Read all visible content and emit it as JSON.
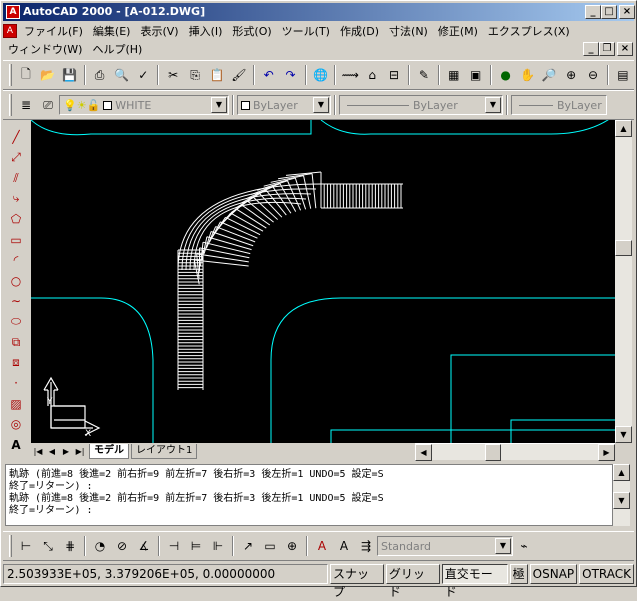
{
  "window": {
    "title": "AutoCAD 2000 - [A-012.DWG]",
    "app_icon": "A"
  },
  "menu": {
    "row1": [
      "ファイル(F)",
      "編集(E)",
      "表示(V)",
      "挿入(I)",
      "形式(O)",
      "ツール(T)",
      "作成(D)",
      "寸法(N)",
      "修正(M)",
      "エクスプレス(X)"
    ],
    "row2": [
      "ウィンドウ(W)",
      "ヘルプ(H)"
    ]
  },
  "layer": {
    "name": "WHITE",
    "color": "ByLayer",
    "linetype": "ByLayer",
    "lineweight": "ByLayer"
  },
  "tabs": {
    "model": "モデル",
    "layout": "レイアウト1"
  },
  "command": {
    "lines": [
      "軌跡 (前進=8 後進=2 前右折=9 前左折=7 後右折=3 後左折=1 UNDO=5 設定=S",
      "終了=リターン) :",
      "軌跡 (前進=8 後進=2 前右折=9 前左折=7 後右折=3 後左折=1 UNDO=5 設定=S",
      "終了=リターン) :"
    ]
  },
  "dimstyle": "Standard",
  "status": {
    "coords": "2.503933E+05, 3.379206E+05, 0.00000000",
    "snap": "スナップ",
    "grid": "グリッド",
    "ortho": "直交モード",
    "polar": "極",
    "osnap": "OSNAP",
    "otrack": "OTRACK"
  },
  "ucs": {
    "x": "X",
    "y": "Y"
  },
  "colors": {
    "road": "#00ffff",
    "background": "#000000",
    "track": "#ffffff"
  }
}
